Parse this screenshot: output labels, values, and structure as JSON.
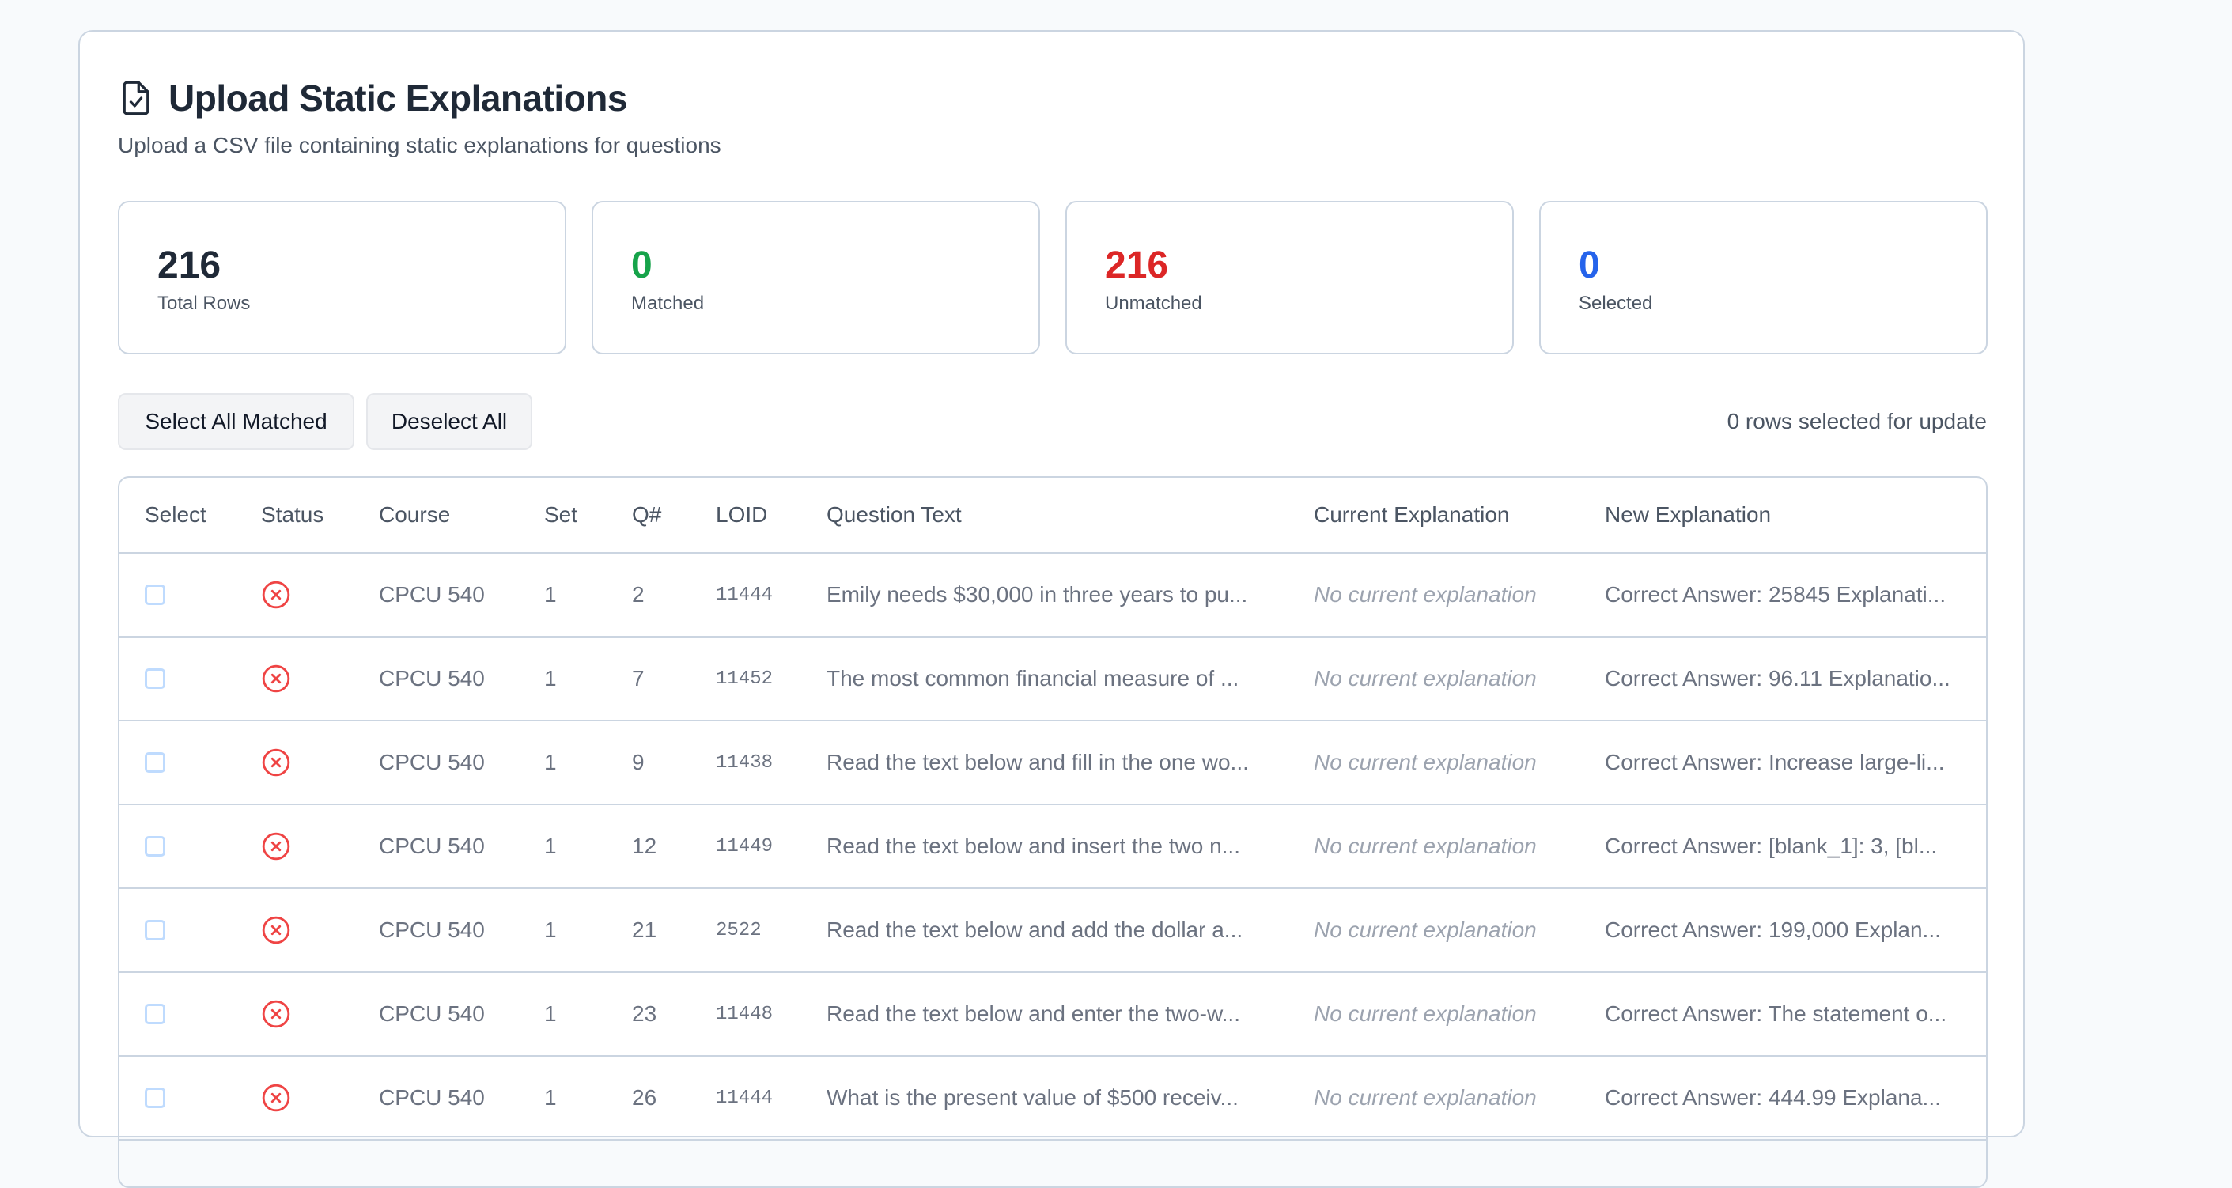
{
  "header": {
    "title": "Upload Static Explanations",
    "subtitle": "Upload a CSV file containing static explanations for questions",
    "title_icon": "file-check-icon"
  },
  "stats": [
    {
      "value": "216",
      "label": "Total Rows",
      "color": "#1f2937"
    },
    {
      "value": "0",
      "label": "Matched",
      "color": "#16a34a"
    },
    {
      "value": "216",
      "label": "Unmatched",
      "color": "#dc2626"
    },
    {
      "value": "0",
      "label": "Selected",
      "color": "#2563eb"
    }
  ],
  "actions": {
    "select_all_matched": "Select All Matched",
    "deselect_all": "Deselect All",
    "rows_selected_text": "0 rows selected for update"
  },
  "table": {
    "columns": [
      "Select",
      "Status",
      "Course",
      "Set",
      "Q#",
      "LOID",
      "Question Text",
      "Current Explanation",
      "New Explanation"
    ],
    "status_icon": "x-circle-icon",
    "status_color": "#ef4444",
    "rows": [
      {
        "course": "CPCU 540",
        "set": "1",
        "q": "2",
        "loid": "11444",
        "question": "Emily needs $30,000 in three years to pu...",
        "current": "No current explanation",
        "new": "Correct Answer: 25845 Explanati..."
      },
      {
        "course": "CPCU 540",
        "set": "1",
        "q": "7",
        "loid": "11452",
        "question": "The most common financial measure of ...",
        "current": "No current explanation",
        "new": "Correct Answer: 96.11 Explanatio..."
      },
      {
        "course": "CPCU 540",
        "set": "1",
        "q": "9",
        "loid": "11438",
        "question": "Read the text below and fill in the one wo...",
        "current": "No current explanation",
        "new": "Correct Answer: Increase large-li..."
      },
      {
        "course": "CPCU 540",
        "set": "1",
        "q": "12",
        "loid": "11449",
        "question": "Read the text below and insert the two n...",
        "current": "No current explanation",
        "new": "Correct Answer: [blank_1]: 3, [bl..."
      },
      {
        "course": "CPCU 540",
        "set": "1",
        "q": "21",
        "loid": "2522",
        "question": "Read the text below and add the dollar a...",
        "current": "No current explanation",
        "new": "Correct Answer: 199,000 Explan..."
      },
      {
        "course": "CPCU 540",
        "set": "1",
        "q": "23",
        "loid": "11448",
        "question": "Read the text below and enter the two-w...",
        "current": "No current explanation",
        "new": "Correct Answer: The statement o..."
      },
      {
        "course": "CPCU 540",
        "set": "1",
        "q": "26",
        "loid": "11444",
        "question": "What is the present value of $500 receiv...",
        "current": "No current explanation",
        "new": "Correct Answer: 444.99 Explana..."
      }
    ]
  }
}
